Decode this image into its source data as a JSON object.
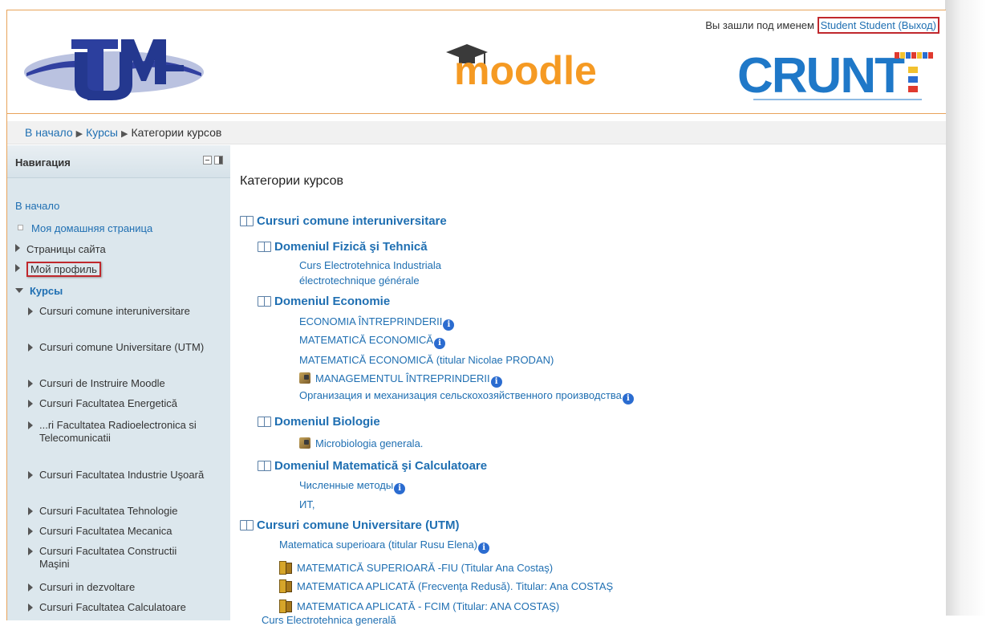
{
  "login": {
    "prefix": "Вы зашли под именем",
    "user": "Student Student",
    "logout": "(Выход)"
  },
  "logos": {
    "left": "UTM",
    "center": "moodle",
    "right": "CRUNT"
  },
  "breadcrumb": {
    "home": "В начало",
    "courses": "Курсы",
    "current": "Категории курсов"
  },
  "nav": {
    "title": "Навигация",
    "home": "В начало",
    "my_home": "Моя домашняя страница",
    "site_pages": "Страницы сайта",
    "my_profile": "Мой профиль",
    "courses": "Курсы",
    "items": [
      "Cursuri comune interuniversitare",
      "Cursuri comune Universitare (UTM)",
      "Cursuri de Instruire Moodle",
      "Cursuri Facultatea Energetică",
      "...ri Facultatea Radioelectronica si Telecomunicatii",
      "Cursuri Facultatea Industrie Uşoară",
      "Cursuri Facultatea Tehnologie",
      "Cursuri Facultatea Mecanica",
      "Cursuri Facultatea Constructii Maşini",
      "Cursuri in dezvoltare",
      "Cursuri Facultatea Calculatoare"
    ]
  },
  "main": {
    "title": "Категории курсов",
    "cat1": "Cursuri comune interuniversitare",
    "sub1": "Domeniul Fizică şi Tehnică",
    "sub1_c1": "Curs Electrotehnica Industriala",
    "sub1_c2": "électrotechnique générale",
    "sub2": "Domeniul Economie",
    "sub2_c1": "ECONOMIA ÎNTREPRINDERII",
    "sub2_c2": "MATEMATICĂ ECONOMICĂ",
    "sub2_c3": "MATEMATICĂ ECONOMICĂ (titular Nicolae PRODAN)",
    "sub2_c4": "MANAGEMENTUL ÎNTREPRINDERII",
    "sub2_c5": "Организация и механизация сельскохозяйственного производства",
    "sub3": "Domeniul Biologie",
    "sub3_c1": "Microbiologia generala.",
    "sub4": "Domeniul Matematică şi Calculatoare",
    "sub4_c1": "Численные методы",
    "sub4_c2": "ИТ,",
    "cat2": "Cursuri comune Universitare (UTM)",
    "cat2_c1": "Matematica superioara (titular Rusu Elena)",
    "cat2_c2": "MATEMATICĂ SUPERIOARĂ -FIU (Titular Ana Costaş)",
    "cat2_c3": "MATEMATICA APLICATĂ (Frecvenţa Redusă). Titular: Ana COSTAŞ",
    "cat2_c4": "MATEMATICA APLICATĂ - FCIM (Titular: ANA COSTAŞ)",
    "cat2_c5": "Curs Electrotehnica generală"
  },
  "icons": {
    "info": "info-icon",
    "guest": "guest-access-icon",
    "key": "enrolment-key-icon",
    "book": "category-book-icon"
  }
}
